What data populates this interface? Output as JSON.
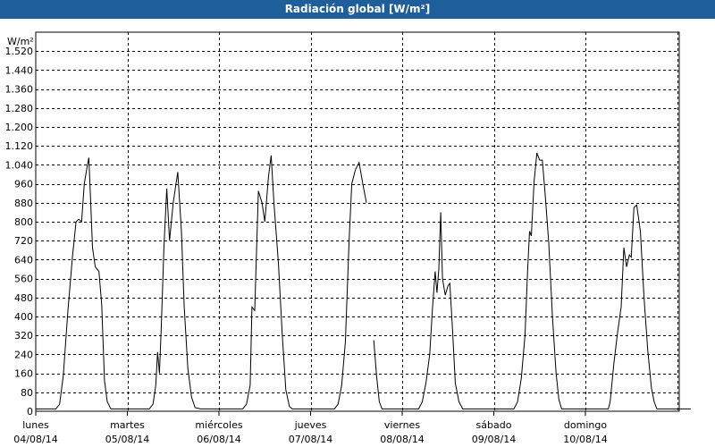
{
  "window": {
    "title": "Radiación global [W/m²]"
  },
  "chart_data": {
    "type": "line",
    "title": "Radiación global [W/m²]",
    "ylabel": "W/m²",
    "ylim": [
      0,
      1600
    ],
    "yticks": [
      0,
      80,
      160,
      240,
      320,
      400,
      480,
      560,
      640,
      720,
      800,
      880,
      960,
      1040,
      1120,
      1200,
      1280,
      1360,
      1440,
      1520
    ],
    "ytick_labels": [
      "0",
      "80",
      "160",
      "240",
      "320",
      "400",
      "480",
      "560",
      "640",
      "720",
      "800",
      "880",
      "960",
      "1.040",
      "1.120",
      "1.200",
      "1.280",
      "1.360",
      "1.440",
      "1.520"
    ],
    "xlim": [
      0,
      7.15
    ],
    "x_unit": "days from 04/08/14 00:00",
    "x_categories": [
      {
        "day": "lunes",
        "date": "04/08/14"
      },
      {
        "day": "martes",
        "date": "05/08/14"
      },
      {
        "day": "miércoles",
        "date": "06/08/14"
      },
      {
        "day": "jueves",
        "date": "07/08/14"
      },
      {
        "day": "viernes",
        "date": "08/08/14"
      },
      {
        "day": "sábado",
        "date": "09/08/14"
      },
      {
        "day": "domingo",
        "date": "10/08/14"
      }
    ],
    "grid": true,
    "line_color": "#000000",
    "series": [
      {
        "segments": [
          [
            [
              0,
              10
            ],
            [
              0.22,
              10
            ],
            [
              0.26,
              30
            ],
            [
              0.3,
              150
            ],
            [
              0.35,
              420
            ],
            [
              0.4,
              650
            ],
            [
              0.44,
              800
            ],
            [
              0.47,
              810
            ],
            [
              0.5,
              800
            ],
            [
              0.53,
              960
            ],
            [
              0.56,
              1030
            ],
            [
              0.58,
              1070
            ],
            [
              0.6,
              880
            ],
            [
              0.62,
              690
            ],
            [
              0.65,
              610
            ],
            [
              0.69,
              590
            ],
            [
              0.72,
              450
            ],
            [
              0.75,
              130
            ],
            [
              0.78,
              40
            ],
            [
              0.82,
              10
            ],
            [
              1.0,
              10
            ],
            [
              1.24,
              10
            ],
            [
              1.28,
              30
            ],
            [
              1.31,
              110
            ],
            [
              1.33,
              250
            ],
            [
              1.35,
              160
            ],
            [
              1.37,
              350
            ],
            [
              1.4,
              700
            ],
            [
              1.43,
              940
            ],
            [
              1.46,
              720
            ],
            [
              1.5,
              880
            ],
            [
              1.55,
              1010
            ],
            [
              1.59,
              760
            ],
            [
              1.62,
              440
            ],
            [
              1.66,
              180
            ],
            [
              1.7,
              60
            ],
            [
              1.74,
              15
            ],
            [
              1.8,
              10
            ],
            [
              2.0,
              10
            ],
            [
              2.26,
              10
            ],
            [
              2.3,
              30
            ],
            [
              2.34,
              110
            ],
            [
              2.36,
              440
            ],
            [
              2.39,
              425
            ],
            [
              2.43,
              930
            ],
            [
              2.47,
              880
            ],
            [
              2.5,
              800
            ],
            [
              2.54,
              990
            ],
            [
              2.57,
              1080
            ],
            [
              2.6,
              880
            ],
            [
              2.65,
              620
            ],
            [
              2.69,
              330
            ],
            [
              2.73,
              90
            ],
            [
              2.77,
              20
            ],
            [
              2.8,
              10
            ],
            [
              3.0,
              10
            ],
            [
              3.26,
              10
            ],
            [
              3.3,
              30
            ],
            [
              3.34,
              110
            ],
            [
              3.38,
              290
            ],
            [
              3.42,
              720
            ],
            [
              3.45,
              960
            ],
            [
              3.49,
              1020
            ],
            [
              3.53,
              1050
            ],
            [
              3.57,
              960
            ],
            [
              3.61,
              880
            ]
          ],
          [
            [
              3.69,
              300
            ],
            [
              3.72,
              150
            ],
            [
              3.75,
              40
            ],
            [
              3.78,
              10
            ],
            [
              4.0,
              10
            ],
            [
              4.18,
              10
            ],
            [
              4.22,
              40
            ],
            [
              4.26,
              120
            ],
            [
              4.3,
              240
            ],
            [
              4.33,
              430
            ],
            [
              4.36,
              590
            ],
            [
              4.38,
              500
            ],
            [
              4.4,
              600
            ],
            [
              4.42,
              840
            ],
            [
              4.44,
              560
            ],
            [
              4.47,
              490
            ],
            [
              4.5,
              530
            ],
            [
              4.52,
              540
            ],
            [
              4.55,
              340
            ],
            [
              4.58,
              120
            ],
            [
              4.62,
              40
            ],
            [
              4.66,
              10
            ],
            [
              5.0,
              10
            ],
            [
              5.22,
              10
            ],
            [
              5.26,
              40
            ],
            [
              5.3,
              140
            ],
            [
              5.34,
              320
            ],
            [
              5.37,
              600
            ],
            [
              5.39,
              760
            ],
            [
              5.41,
              740
            ],
            [
              5.44,
              970
            ],
            [
              5.47,
              1090
            ],
            [
              5.5,
              1060
            ],
            [
              5.53,
              1060
            ],
            [
              5.56,
              920
            ],
            [
              5.6,
              710
            ],
            [
              5.64,
              400
            ],
            [
              5.68,
              160
            ],
            [
              5.71,
              50
            ],
            [
              5.74,
              10
            ],
            [
              6.0,
              10
            ],
            [
              6.25,
              10
            ],
            [
              6.27,
              40
            ],
            [
              6.31,
              200
            ],
            [
              6.35,
              330
            ],
            [
              6.39,
              440
            ],
            [
              6.42,
              690
            ],
            [
              6.45,
              610
            ],
            [
              6.48,
              660
            ],
            [
              6.5,
              650
            ],
            [
              6.53,
              860
            ],
            [
              6.56,
              870
            ],
            [
              6.6,
              760
            ],
            [
              6.64,
              480
            ],
            [
              6.68,
              260
            ],
            [
              6.72,
              100
            ],
            [
              6.75,
              40
            ],
            [
              6.78,
              10
            ],
            [
              7.15,
              10
            ]
          ]
        ]
      }
    ]
  }
}
